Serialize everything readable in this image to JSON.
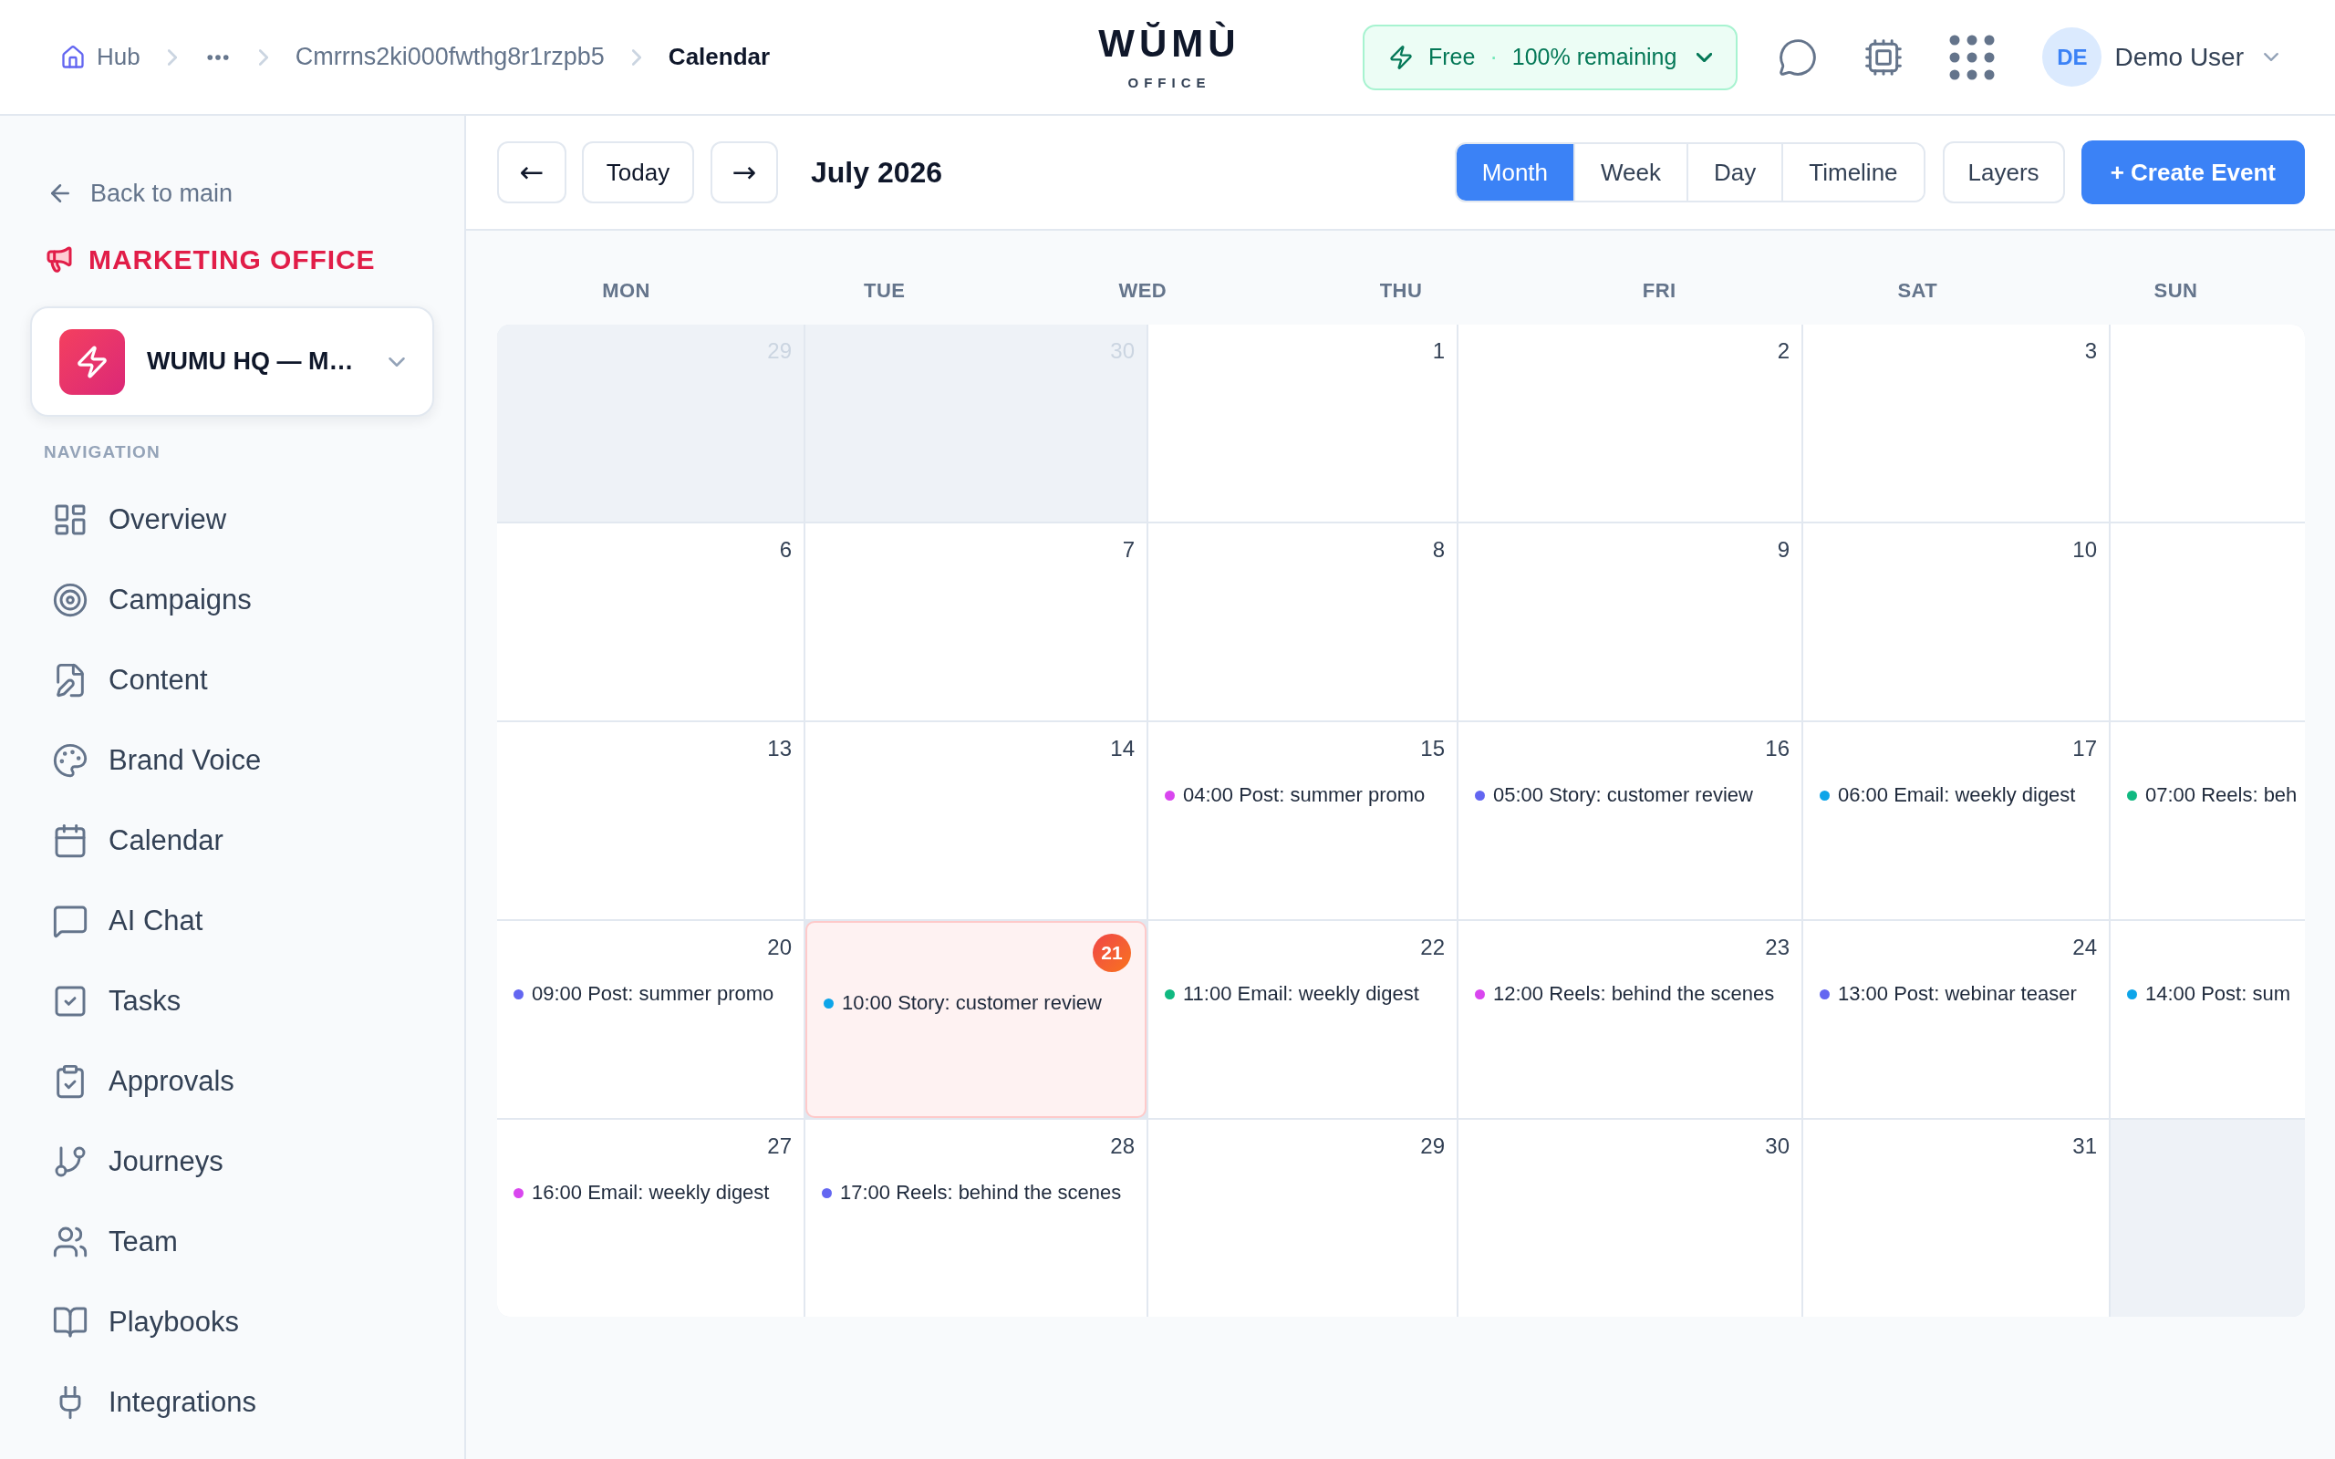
{
  "breadcrumb": [
    {
      "kind": "home",
      "label": "Hub"
    },
    {
      "kind": "ellipsis"
    },
    {
      "kind": "link",
      "label": "Cmrrns2ki000fwthg8r1rzpb5"
    },
    {
      "kind": "current",
      "label": "Calendar"
    }
  ],
  "logo": {
    "wordmark": "WŬMÙ",
    "tagline": "OFFICE"
  },
  "plan": {
    "name": "Free",
    "separator": "·",
    "remaining": "100% remaining"
  },
  "user": {
    "initials": "DE",
    "name": "Demo User"
  },
  "sidebar": {
    "back": "Back to main",
    "office": "MARKETING OFFICE",
    "workspace": "WUMU HQ — M…",
    "section": "NAVIGATION",
    "items": [
      {
        "label": "Overview"
      },
      {
        "label": "Campaigns"
      },
      {
        "label": "Content"
      },
      {
        "label": "Brand Voice"
      },
      {
        "label": "Calendar"
      },
      {
        "label": "AI Chat"
      },
      {
        "label": "Tasks"
      },
      {
        "label": "Approvals"
      },
      {
        "label": "Journeys"
      },
      {
        "label": "Team"
      },
      {
        "label": "Playbooks"
      },
      {
        "label": "Integrations"
      }
    ]
  },
  "toolbar": {
    "prev": "←",
    "today": "Today",
    "next": "→",
    "title": "July 2026",
    "views": [
      {
        "label": "Month",
        "selected": true
      },
      {
        "label": "Week",
        "selected": false
      },
      {
        "label": "Day",
        "selected": false
      },
      {
        "label": "Timeline",
        "selected": false
      }
    ],
    "layers": "Layers",
    "create": "+ Create Event"
  },
  "calendar": {
    "weekdays": [
      "MON",
      "TUE",
      "WED",
      "THU",
      "FRI",
      "SAT",
      "SUN"
    ],
    "weeks": [
      {
        "days": [
          {
            "day": "29",
            "outside": true,
            "today": false
          },
          {
            "day": "30",
            "outside": true,
            "today": false
          },
          {
            "day": "1",
            "outside": false,
            "today": false
          },
          {
            "day": "2",
            "outside": false,
            "today": false
          },
          {
            "day": "3",
            "outside": false,
            "today": false
          },
          {
            "outside": false,
            "today": false
          }
        ]
      },
      {
        "days": [
          {
            "day": "6",
            "outside": false,
            "today": false
          },
          {
            "day": "7",
            "outside": false,
            "today": false
          },
          {
            "day": "8",
            "outside": false,
            "today": false
          },
          {
            "day": "9",
            "outside": false,
            "today": false
          },
          {
            "day": "10",
            "outside": false,
            "today": false
          },
          {
            "outside": false,
            "today": false
          }
        ]
      },
      {
        "days": [
          {
            "day": "13",
            "outside": false,
            "today": false
          },
          {
            "day": "14",
            "outside": false,
            "today": false
          },
          {
            "day": "15",
            "outside": false,
            "today": false,
            "events": [
              {
                "text": "04:00 Post: summer promo",
                "color": "#d946ef"
              }
            ]
          },
          {
            "day": "16",
            "outside": false,
            "today": false,
            "events": [
              {
                "text": "05:00 Story: customer review",
                "color": "#6366f1"
              }
            ]
          },
          {
            "day": "17",
            "outside": false,
            "today": false,
            "events": [
              {
                "text": "06:00 Email: weekly digest",
                "color": "#0ea5e9"
              }
            ]
          },
          {
            "outside": false,
            "today": false,
            "events": [
              {
                "text": "07:00 Reels: beh",
                "color": "#10b981"
              }
            ]
          }
        ]
      },
      {
        "days": [
          {
            "day": "20",
            "outside": false,
            "today": false,
            "events": [
              {
                "text": "09:00 Post: summer promo",
                "color": "#6366f1"
              }
            ]
          },
          {
            "day": "21",
            "outside": false,
            "today": true,
            "events": [
              {
                "text": "10:00 Story: customer review",
                "color": "#0ea5e9"
              }
            ]
          },
          {
            "day": "22",
            "outside": false,
            "today": false,
            "events": [
              {
                "text": "11:00 Email: weekly digest",
                "color": "#10b981"
              }
            ]
          },
          {
            "day": "23",
            "outside": false,
            "today": false,
            "events": [
              {
                "text": "12:00 Reels: behind the scenes",
                "color": "#d946ef"
              }
            ]
          },
          {
            "day": "24",
            "outside": false,
            "today": false,
            "events": [
              {
                "text": "13:00 Post: webinar teaser",
                "color": "#6366f1"
              }
            ]
          },
          {
            "outside": false,
            "today": false,
            "events": [
              {
                "text": "14:00 Post: sum",
                "color": "#0ea5e9"
              }
            ]
          }
        ]
      },
      {
        "days": [
          {
            "day": "27",
            "outside": false,
            "today": false,
            "events": [
              {
                "text": "16:00 Email: weekly digest",
                "color": "#d946ef"
              }
            ]
          },
          {
            "day": "28",
            "outside": false,
            "today": false,
            "events": [
              {
                "text": "17:00 Reels: behind the scenes",
                "color": "#6366f1"
              }
            ]
          },
          {
            "day": "29",
            "outside": false,
            "today": false
          },
          {
            "day": "30",
            "outside": false,
            "today": false
          },
          {
            "day": "31",
            "outside": false,
            "today": false
          },
          {
            "outside": true,
            "today": false
          }
        ]
      }
    ]
  }
}
